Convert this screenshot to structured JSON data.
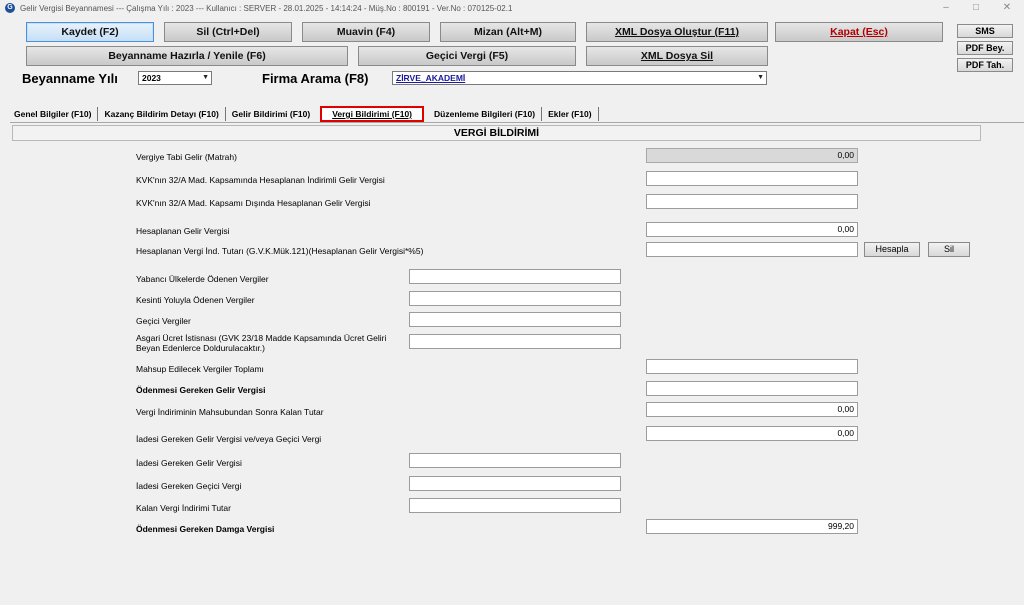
{
  "window": {
    "title": "Gelir Vergisi Beyannamesi  ---  Çalışma Yılı : 2023   ---   Kullanıcı : SERVER - 28.01.2025 - 14:14:24 - Müş.No : 800191 - Ver.No : 070125-02.1",
    "minimize": "–",
    "maximize": "□",
    "close": "✕"
  },
  "toolbar": {
    "kaydet": "Kaydet (F2)",
    "sil": "Sil (Ctrl+Del)",
    "muavin": "Muavin (F4)",
    "mizan": "Mizan (Alt+M)",
    "xml_olustur": "XML Dosya Oluştur (F11)",
    "kapat": "Kapat (Esc)",
    "beyanname_hazirla": "Beyanname Hazırla / Yenile (F6)",
    "gecici_vergi": "Geçici Vergi (F5)",
    "xml_sil": "XML Dosya Sil",
    "sms": "SMS",
    "pdf_bey": "PDF Bey.",
    "pdf_tah": "PDF Tah."
  },
  "filters": {
    "beyanname_yili_label": "Beyanname Yılı",
    "beyanname_yili_value": "2023",
    "firma_arama_label": "Firma Arama (F8)",
    "firma_value": "ZİRVE_AKADEMİ"
  },
  "tabs": [
    {
      "label": "Genel Bilgiler (F10)"
    },
    {
      "label": "Kazanç Bildirim Detayı (F10)"
    },
    {
      "label": "Gelir Bildirimi (F10)"
    },
    {
      "label": "Vergi Bildirimi (F10)"
    },
    {
      "label": "Düzenleme Bilgileri (F10)"
    },
    {
      "label": "Ekler (F10)"
    }
  ],
  "section_title": "VERGİ BİLDİRİMİ",
  "fields": [
    {
      "label": "Vergiye Tabi Gelir (Matrah)",
      "value": "0,00"
    },
    {
      "label": "KVK'nın 32/A Mad. Kapsamında Hesaplanan İndirimli Gelir Vergisi",
      "value": ""
    },
    {
      "label": "KVK'nın 32/A Mad. Kapsamı Dışında Hesaplanan Gelir Vergisi",
      "value": ""
    },
    {
      "label": "Hesaplanan Gelir Vergisi",
      "value": "0,00"
    },
    {
      "label": "Hesaplanan Vergi İnd. Tutarı (G.V.K.Mük.121)(Hesaplanan Gelir Vergisi*%5)",
      "value": ""
    },
    {
      "label": "Yabancı Ülkelerde Ödenen Vergiler",
      "value": ""
    },
    {
      "label": "Kesinti Yoluyla Ödenen Vergiler",
      "value": ""
    },
    {
      "label": "Geçici Vergiler",
      "value": ""
    },
    {
      "label": "Asgari Ücret İstisnası (GVK 23/18 Madde Kapsamında Ücret Geliri Beyan Edenlerce Doldurulacaktır.)",
      "value": ""
    },
    {
      "label": "Mahsup Edilecek Vergiler Toplamı",
      "value": ""
    },
    {
      "label": "Ödenmesi Gereken Gelir Vergisi",
      "value": ""
    },
    {
      "label": "Vergi İndiriminin Mahsubundan Sonra Kalan Tutar",
      "value": "0,00"
    },
    {
      "label": "İadesi Gereken Gelir Vergisi ve/veya Geçici Vergi",
      "value": "0,00"
    },
    {
      "label": "İadesi Gereken Gelir Vergisi",
      "value": ""
    },
    {
      "label": "İadesi Gereken Geçici Vergi",
      "value": ""
    },
    {
      "label": "Kalan Vergi İndirimi Tutar",
      "value": ""
    },
    {
      "label": "Ödenmesi Gereken Damga Vergisi",
      "value": "999,20"
    }
  ],
  "buttons": {
    "hesapla": "Hesapla",
    "sil": "Sil"
  }
}
